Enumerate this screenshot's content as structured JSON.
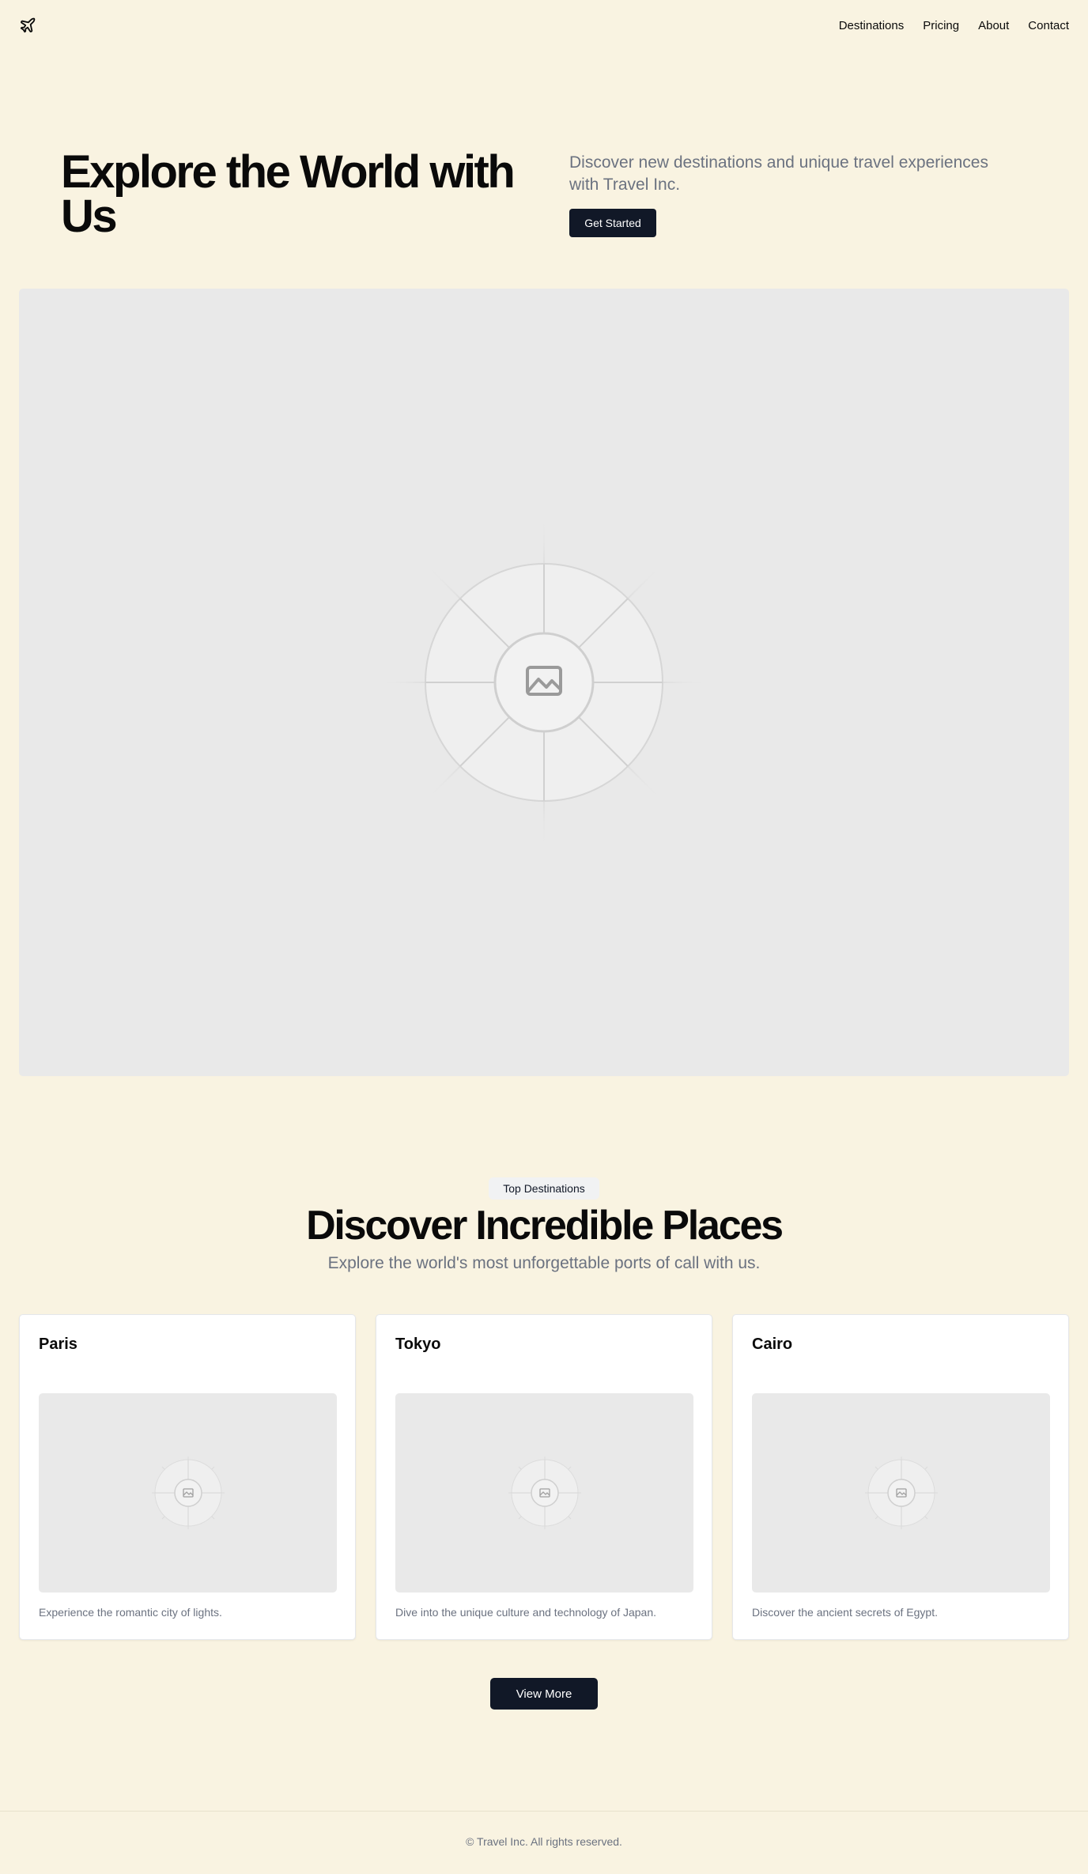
{
  "header": {
    "logo_icon": "plane-icon",
    "nav": [
      "Destinations",
      "Pricing",
      "About",
      "Contact"
    ]
  },
  "hero": {
    "title": "Explore the World with Us",
    "subtitle": "Discover new destinations and unique travel experiences with Travel Inc.",
    "cta_label": "Get Started",
    "image_icon": "image-placeholder-icon"
  },
  "destinations": {
    "badge": "Top Destinations",
    "title": "Discover Incredible Places",
    "subtitle": "Explore the world's most unforgettable ports of call with us.",
    "cards": [
      {
        "title": "Paris",
        "description": "Experience the romantic city of lights."
      },
      {
        "title": "Tokyo",
        "description": "Dive into the unique culture and technology of Japan."
      },
      {
        "title": "Cairo",
        "description": "Discover the ancient secrets of Egypt."
      }
    ],
    "view_more_label": "View More"
  },
  "footer": {
    "copyright": "© Travel Inc. All rights reserved."
  },
  "colors": {
    "background": "#f9f3e1",
    "primary_button": "#111827",
    "muted_text": "#6b7280",
    "placeholder_bg": "#e9e9e9"
  }
}
